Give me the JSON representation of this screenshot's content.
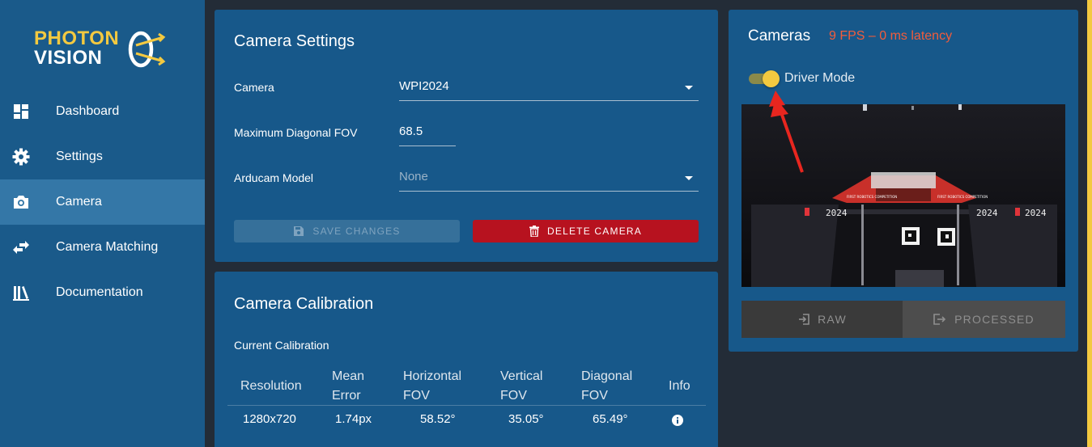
{
  "brand": {
    "line1": "PHOTON",
    "line2": "VISION"
  },
  "sidebar": {
    "items": [
      {
        "label": "Dashboard",
        "icon": "dashboard-icon",
        "active": false
      },
      {
        "label": "Settings",
        "icon": "gear-icon",
        "active": false
      },
      {
        "label": "Camera",
        "icon": "camera-icon",
        "active": true
      },
      {
        "label": "Camera Matching",
        "icon": "swap-arrows-icon",
        "active": false
      },
      {
        "label": "Documentation",
        "icon": "books-icon",
        "active": false
      }
    ]
  },
  "camera_settings": {
    "title": "Camera Settings",
    "camera_label": "Camera",
    "camera_value": "WPI2024",
    "fov_label": "Maximum Diagonal FOV",
    "fov_value": "68.5",
    "arducam_label": "Arducam Model",
    "arducam_value": "None",
    "save_label": "Save Changes",
    "delete_label": "Delete Camera"
  },
  "calibration": {
    "title": "Camera Calibration",
    "current_label": "Current Calibration",
    "headers": {
      "resolution": "Resolution",
      "mean_error_1": "Mean",
      "mean_error_2": "Error",
      "hfov_1": "Horizontal",
      "hfov_2": "FOV",
      "vfov_1": "Vertical",
      "vfov_2": "FOV",
      "dfov_1": "Diagonal",
      "dfov_2": "FOV",
      "info": "Info"
    },
    "rows": [
      {
        "resolution": "1280x720",
        "mean_error": "1.74px",
        "hfov": "58.52°",
        "vfov": "35.05°",
        "dfov": "65.49°"
      }
    ]
  },
  "cameras_panel": {
    "title": "Cameras",
    "fps_text": "9 FPS – 0 ms latency",
    "driver_mode_label": "Driver Mode",
    "driver_mode_on": true,
    "raw_label": "RAW",
    "processed_label": "PROCESSED",
    "feed_scoreboard_left": "2024",
    "feed_scoreboard_right": "2024",
    "feed_logo_text": "FIRST ROBOTICS COMPETITION"
  },
  "colors": {
    "sidebar_bg": "#1a5a8a",
    "panel_bg": "#17588a",
    "accent_yellow": "#f3c940",
    "delete_red": "#b7121f",
    "fps_red": "#f25c3b"
  }
}
